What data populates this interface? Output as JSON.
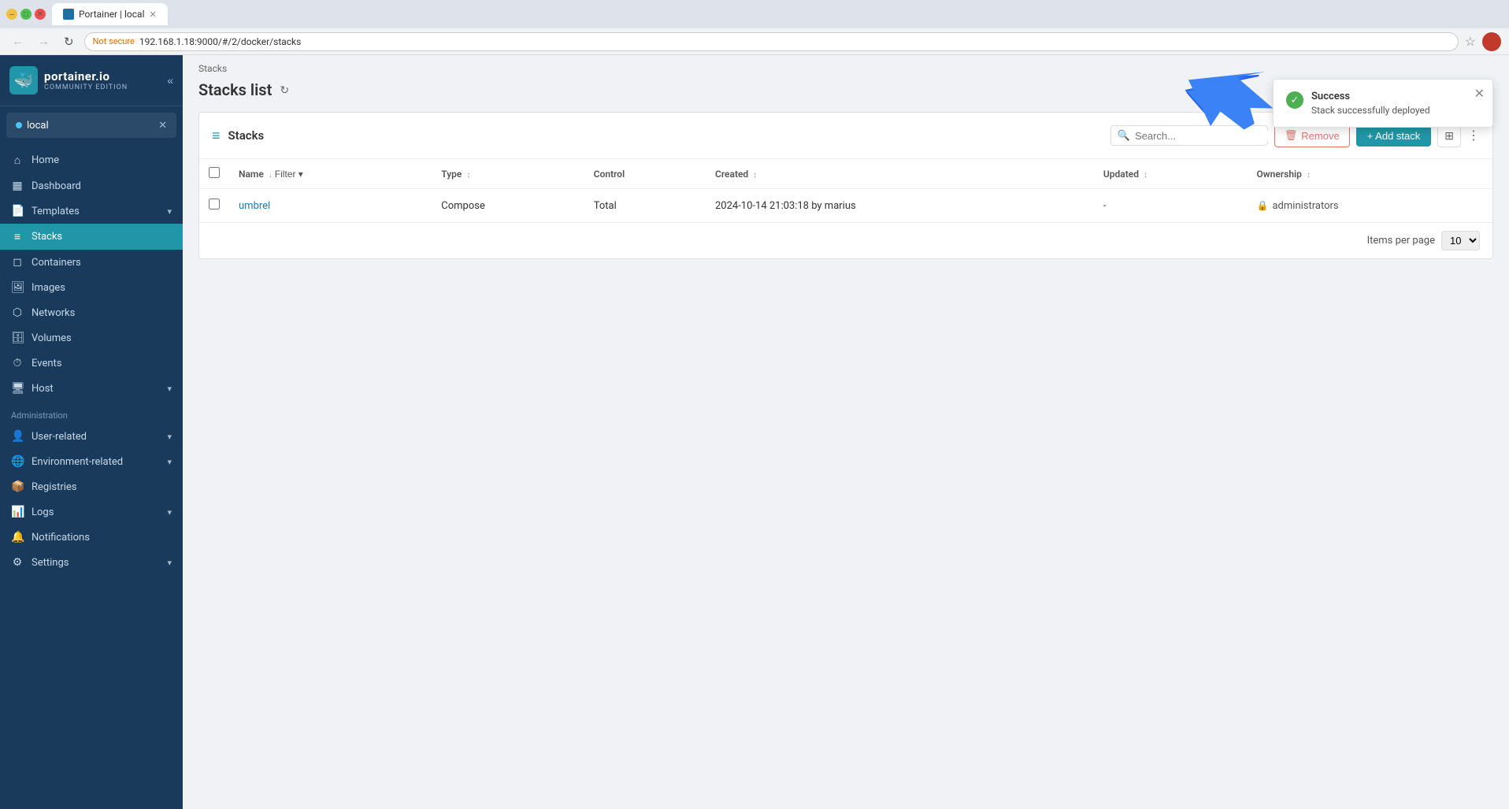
{
  "browser": {
    "tab_label": "Portainer | local",
    "url": "192.168.1.18:9000/#/2/docker/stacks",
    "security_label": "Not secure"
  },
  "sidebar": {
    "logo_name": "portainer.io",
    "logo_sub": "Community Edition",
    "env_name": "local",
    "nav_items": [
      {
        "id": "home",
        "label": "Home",
        "icon": "⌂"
      },
      {
        "id": "dashboard",
        "label": "Dashboard",
        "icon": "▦"
      },
      {
        "id": "templates",
        "label": "Templates",
        "icon": "📄",
        "has_chevron": true
      },
      {
        "id": "stacks",
        "label": "Stacks",
        "icon": "≡",
        "active": true
      },
      {
        "id": "containers",
        "label": "Containers",
        "icon": "◻"
      },
      {
        "id": "images",
        "label": "Images",
        "icon": "🖼"
      },
      {
        "id": "networks",
        "label": "Networks",
        "icon": "⬡"
      },
      {
        "id": "volumes",
        "label": "Volumes",
        "icon": "🗄"
      },
      {
        "id": "events",
        "label": "Events",
        "icon": "⏱"
      },
      {
        "id": "host",
        "label": "Host",
        "icon": "🖥",
        "has_chevron": true
      }
    ],
    "admin_section": "Administration",
    "admin_items": [
      {
        "id": "user-related",
        "label": "User-related",
        "icon": "👤",
        "has_chevron": true
      },
      {
        "id": "environment-related",
        "label": "Environment-related",
        "icon": "🌐",
        "has_chevron": true
      },
      {
        "id": "registries",
        "label": "Registries",
        "icon": "📦"
      },
      {
        "id": "logs",
        "label": "Logs",
        "icon": "📊",
        "has_chevron": true
      },
      {
        "id": "notifications",
        "label": "Notifications",
        "icon": "🔔"
      },
      {
        "id": "settings",
        "label": "Settings",
        "icon": "⚙",
        "has_chevron": true
      }
    ]
  },
  "main": {
    "breadcrumb": "Stacks",
    "page_title": "Stacks list",
    "panel_title": "Stacks",
    "search_placeholder": "Search...",
    "btn_remove": "Remove",
    "btn_add_stack": "+ Add stack",
    "table": {
      "columns": [
        "Name",
        "Filter",
        "Type",
        "Control",
        "Created",
        "Updated",
        "Ownership"
      ],
      "rows": [
        {
          "name": "umbrel",
          "type": "Compose",
          "control": "Total",
          "created": "2024-10-14 21:03:18 by marius",
          "updated": "-",
          "ownership": "administrators"
        }
      ]
    },
    "items_per_page_label": "Items per page",
    "per_page_value": "10"
  },
  "notification": {
    "title": "Success",
    "message": "Stack successfully deployed"
  }
}
